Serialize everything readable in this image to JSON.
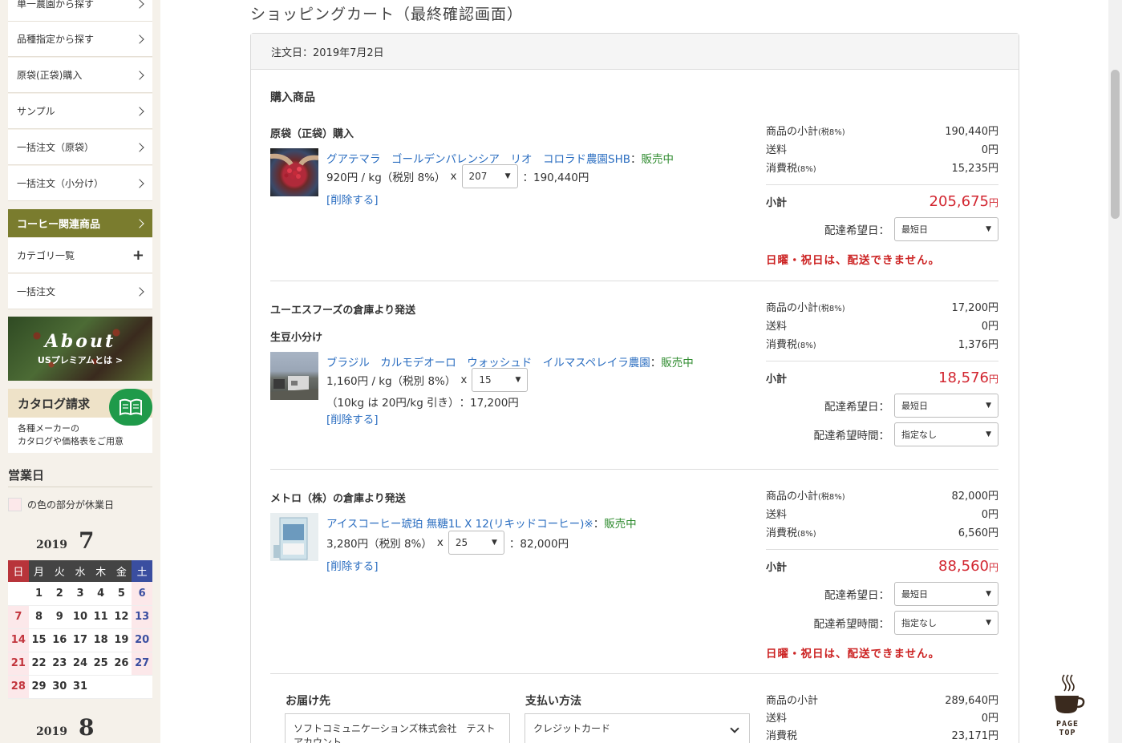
{
  "sidebar": {
    "items_top": [
      {
        "label": "単一農園から探す"
      },
      {
        "label": "品種指定から探す"
      },
      {
        "label": "原袋(正袋)購入"
      },
      {
        "label": "サンプル"
      },
      {
        "label": "一括注文（原袋）"
      },
      {
        "label": "一括注文（小分け）"
      }
    ],
    "category_label": "コーヒー関連商品",
    "items_bottom": [
      {
        "label": "カテゴリ一覧"
      },
      {
        "label": "一括注文"
      }
    ],
    "about": {
      "title": "About",
      "subtitle": "USプレミアムとは >"
    },
    "catalog": {
      "title": "カタログ請求",
      "desc1": "各種メーカーの",
      "desc2": "カタログや価格表をご用意"
    },
    "business_days_title": "営業日",
    "legend_text": "の色の部分が休業日",
    "calendar": {
      "year": "2019",
      "month": "7",
      "weekdays": [
        "日",
        "月",
        "火",
        "水",
        "木",
        "金",
        "土"
      ],
      "weeks": [
        [
          "",
          "1",
          "2",
          "3",
          "4",
          "5",
          "6"
        ],
        [
          "7",
          "8",
          "9",
          "10",
          "11",
          "12",
          "13"
        ],
        [
          "14",
          "15",
          "16",
          "17",
          "18",
          "19",
          "20"
        ],
        [
          "21",
          "22",
          "23",
          "24",
          "25",
          "26",
          "27"
        ],
        [
          "28",
          "29",
          "30",
          "31",
          "",
          "",
          ""
        ]
      ],
      "next_year": "2019",
      "next_month": "8"
    }
  },
  "main": {
    "title": "ショッピングカート（最終確認画面）",
    "order_date": "注文日：2019年7月2日",
    "section_title": "購入商品",
    "groups": [
      {
        "title": "原袋（正袋）購入",
        "subtitle": "",
        "product": {
          "name": "グアテマラ　ゴールデンパレンシア　リオ　コロラド農園SHB",
          "status": "販売中",
          "price": "920円 / kg（税別 8%）",
          "qty": "207",
          "line_total": "：190,440円",
          "discount": "",
          "delete_label": "[削除する]"
        },
        "summary": {
          "subtotal_label": "商品の小計",
          "subtotal_tax": "(税8%)",
          "subtotal": "190,440円",
          "shipping_label": "送料",
          "shipping": "0円",
          "tax_label": "消費税",
          "tax_rate": "(8%)",
          "tax": "15,235円",
          "total_label": "小計",
          "total": "205,675",
          "total_unit": "円",
          "date_label": "配達希望日：",
          "date_value": "最短日",
          "time_label": "",
          "time_value": "",
          "warning": "日曜・祝日は、配送できません。"
        }
      },
      {
        "title": "ユーエスフーズの倉庫より発送",
        "subtitle": "生豆小分け",
        "product": {
          "name": "ブラジル　カルモデオーロ　ウォッシュド　イルマスペレイラ農園",
          "status": "販売中",
          "price": "1,160円 / kg（税別 8%）",
          "qty": "15",
          "line_total": "：17,200円",
          "discount": "（10kg は 20円/kg 引き）",
          "delete_label": "[削除する]"
        },
        "summary": {
          "subtotal_label": "商品の小計",
          "subtotal_tax": "(税8%)",
          "subtotal": "17,200円",
          "shipping_label": "送料",
          "shipping": "0円",
          "tax_label": "消費税",
          "tax_rate": "(8%)",
          "tax": "1,376円",
          "total_label": "小計",
          "total": "18,576",
          "total_unit": "円",
          "date_label": "配達希望日：",
          "date_value": "最短日",
          "time_label": "配達希望時間：",
          "time_value": "指定なし",
          "warning": ""
        }
      },
      {
        "title": "メトロ（株）の倉庫より発送",
        "subtitle": "",
        "product": {
          "name": "アイスコーヒー琥珀 無糖1L X 12(リキッドコーヒー)※",
          "status": "販売中",
          "price": "3,280円（税別 8%）",
          "qty": "25",
          "line_total": "：82,000円",
          "discount": "",
          "delete_label": "[削除する]"
        },
        "summary": {
          "subtotal_label": "商品の小計",
          "subtotal_tax": "(税8%)",
          "subtotal": "82,000円",
          "shipping_label": "送料",
          "shipping": "0円",
          "tax_label": "消費税",
          "tax_rate": "(8%)",
          "tax": "6,560円",
          "total_label": "小計",
          "total": "88,560",
          "total_unit": "円",
          "date_label": "配達希望日：",
          "date_value": "最短日",
          "time_label": "配達希望時間：",
          "time_value": "指定なし",
          "warning": "日曜・祝日は、配送できません。"
        }
      }
    ],
    "footer": {
      "delivery_title": "お届け先",
      "delivery_value": "ソフトコミュニケーションズ株式会社　テストアカウント",
      "payment_title": "支払い方法",
      "payment_value": "クレジットカード",
      "grand": {
        "subtotal_label": "商品の小計",
        "subtotal": "289,640円",
        "shipping_label": "送料",
        "shipping": "0円",
        "tax_label": "消費税",
        "tax": "23,171円"
      }
    }
  },
  "page_top_label": "PAGE TOP",
  "colors": {
    "accent_olive": "#7a7c2e",
    "link_blue": "#2a6dc0",
    "status_green": "#2e8b2e",
    "price_red": "#d22630",
    "warning_red": "#cc2222"
  }
}
